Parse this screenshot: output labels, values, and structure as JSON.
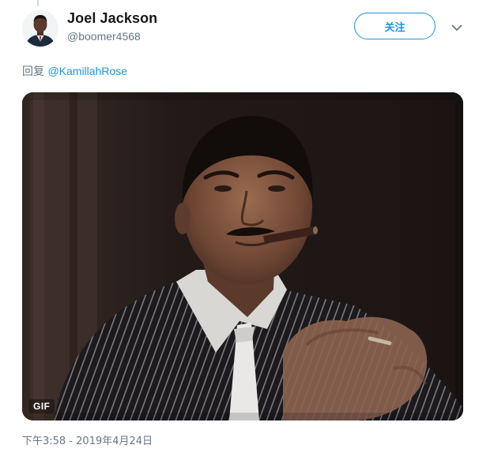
{
  "tweet": {
    "author": {
      "display_name": "Joel Jackson",
      "screen_name": "@boomer4568",
      "avatar_icon": "user-avatar"
    },
    "follow_label": "关注",
    "more_icon": "chevron-down-icon",
    "reply": {
      "prefix": "回复",
      "mention": "@KamillahRose"
    },
    "media": {
      "badge": "GIF"
    },
    "timestamp": "下午3:58 - 2019年4月24日"
  },
  "colors": {
    "accent": "#1b95e0",
    "secondary_text": "#657786",
    "primary_text": "#14171a"
  }
}
